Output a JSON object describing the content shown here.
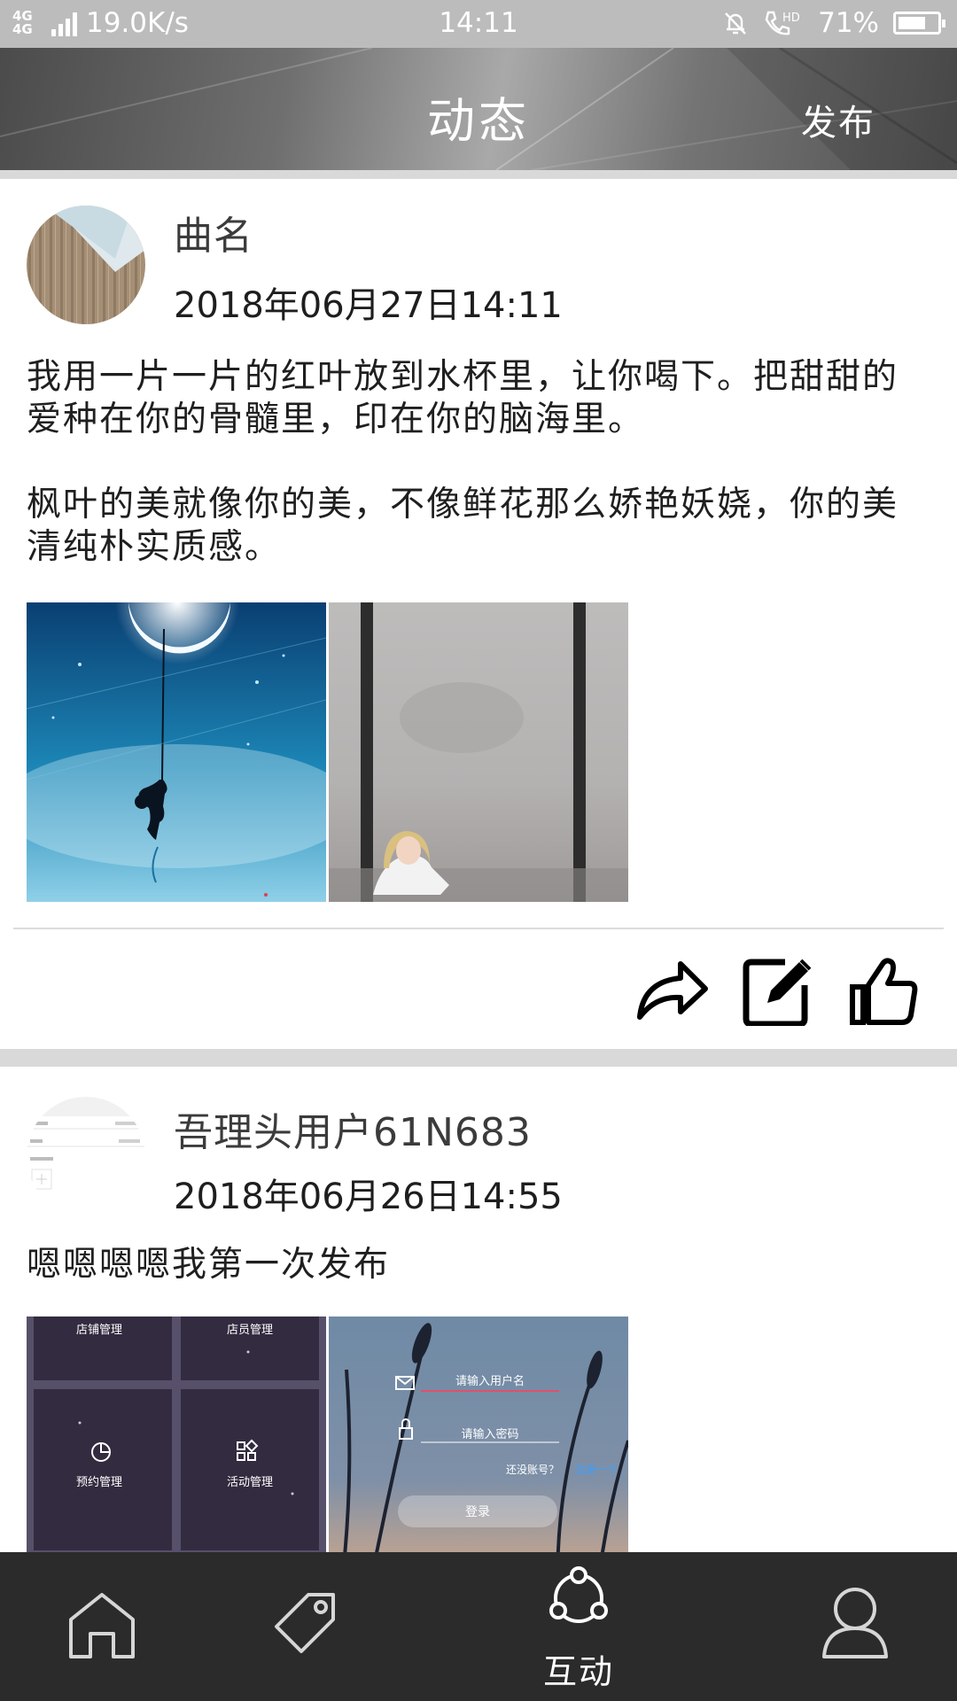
{
  "status_bar": {
    "network": "4G 4G",
    "speed": "19.0K/s",
    "time": "14:11",
    "hd": "HD",
    "battery": "71%",
    "battery_level": 0.71
  },
  "header": {
    "title": "动态",
    "publish_label": "发布"
  },
  "posts": [
    {
      "username": "曲名",
      "datetime": "2018年06月27日14:11",
      "paragraphs": [
        "我用一片一片的红叶放到水杯里，让你喝下。把甜甜的",
        "爱种在你的骨髓里，印在你的脑海里。",
        "",
        "枫叶的美就像你的美，不像鲜花那么娇艳妖娆，你的美",
        "清纯朴实质感。"
      ],
      "photos": [
        "moon-swing-photo",
        "girl-window-photo"
      ],
      "actions": [
        "share-icon",
        "edit-icon",
        "like-icon"
      ]
    },
    {
      "username": "吾理头用户61N683",
      "datetime": "2018年06月26日14:55",
      "paragraphs": [
        "嗯嗯嗯嗯我第一次发布"
      ],
      "photos": [
        {
          "kind": "store-dashboard-screenshot",
          "tiles": [
            "店铺管理",
            "店员管理",
            "预约管理",
            "活动管理"
          ]
        },
        {
          "kind": "login-screenshot",
          "username_placeholder": "请输入用户名",
          "password_placeholder": "请输入密码",
          "no_account": "还没账号？",
          "register_link": "注册一个",
          "login_button": "登录"
        }
      ]
    }
  ],
  "tabbar": {
    "tabs": [
      {
        "icon": "home-icon",
        "label": ""
      },
      {
        "icon": "tag-icon",
        "label": ""
      },
      {
        "icon": "share-network-icon",
        "label": "互动",
        "active": true
      },
      {
        "icon": "user-icon",
        "label": ""
      }
    ]
  }
}
